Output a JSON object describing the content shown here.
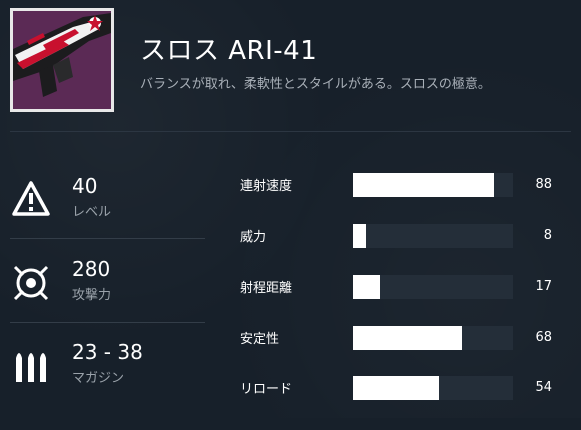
{
  "weapon": {
    "name": "スロス ARI-41",
    "description": "バランスが取れ、柔軟性とスタイルがある。スロスの極意。",
    "thumbnail_icon": "auto-rifle-icon"
  },
  "left_stats": [
    {
      "icon": "warning-triangle-icon",
      "value": "40",
      "label": "レベル"
    },
    {
      "icon": "attack-crosshair-icon",
      "value": "280",
      "label": "攻撃力"
    },
    {
      "icon": "ammo-bullets-icon",
      "value": "23 - 38",
      "label": "マガジン"
    }
  ],
  "stats": [
    {
      "label": "連射速度",
      "value": "88",
      "fraction": 0.88
    },
    {
      "label": "威力",
      "value": "8",
      "fraction": 0.08
    },
    {
      "label": "射程距離",
      "value": "17",
      "fraction": 0.17
    },
    {
      "label": "安定性",
      "value": "68",
      "fraction": 0.68
    },
    {
      "label": "リロード",
      "value": "54",
      "fraction": 0.54
    }
  ],
  "colors": {
    "background": "#17202a",
    "bar_fill": "#ffffff",
    "bar_track": "#242e39",
    "thumbnail_bg": "#5b2a55",
    "accent_red": "#c8102e"
  }
}
